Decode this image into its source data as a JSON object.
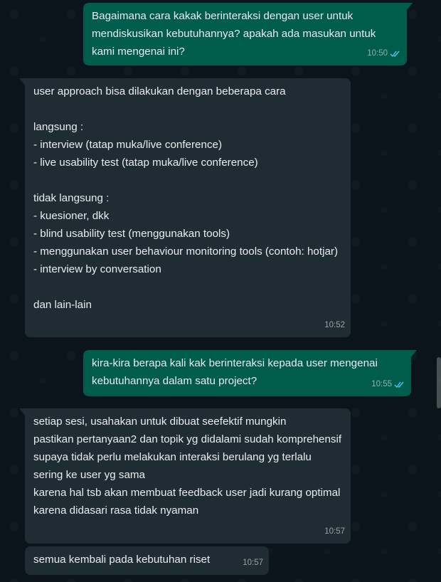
{
  "colors": {
    "background": "#0b141a",
    "outgoing_bubble": "#005c4b",
    "incoming_bubble": "#202c33",
    "read_ticks": "#53bdeb"
  },
  "messages": [
    {
      "direction": "outgoing",
      "text": "Bagaimana cara kakak berinteraksi dengan user untuk mendiskusikan kebutuhannya? apakah ada masukan untuk kami mengenai ini?",
      "time": "10:50",
      "status": "read"
    },
    {
      "direction": "incoming",
      "text": "user approach bisa dilakukan dengan beberapa cara\n\nlangsung :\n- interview (tatap muka/live conference)\n- live usability test (tatap muka/live conference)\n\ntidak langsung :\n- kuesioner, dkk\n- blind usability test (menggunakan tools)\n- menggunakan user behaviour monitoring tools (contoh: hotjar)\n- interview by conversation\n\ndan lain-lain",
      "time": "10:52"
    },
    {
      "direction": "outgoing",
      "text": "kira-kira berapa kali kak berinteraksi kepada user mengenai kebutuhannya dalam satu project?",
      "time": "10:55",
      "status": "read"
    },
    {
      "direction": "incoming",
      "text": "setiap sesi, usahakan untuk dibuat seefektif mungkin\npastikan pertanyaan2 dan topik yg didalami sudah komprehensif\nsupaya tidak perlu melakukan interaksi berulang yg terlalu sering ke user yg sama\nkarena hal tsb akan membuat feedback user jadi kurang optimal karena didasari rasa tidak nyaman",
      "time": "10:57"
    },
    {
      "direction": "incoming",
      "text": "semua kembali pada kebutuhan riset",
      "time": "10:57"
    }
  ]
}
